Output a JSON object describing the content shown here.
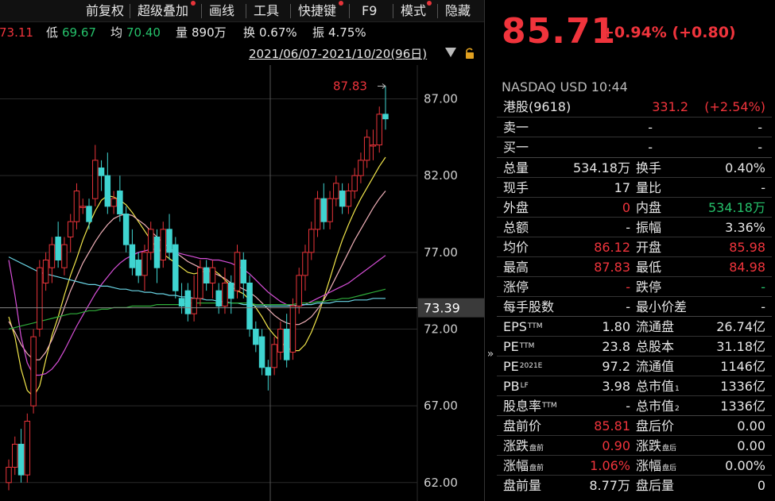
{
  "toolbar": {
    "items": [
      {
        "label": "前复权",
        "dot": false
      },
      {
        "label": "超级叠加",
        "dot": true
      },
      {
        "label": "画线",
        "dot": false
      },
      {
        "label": "工具",
        "dot": false
      },
      {
        "label": "快捷键",
        "dot": true
      },
      {
        "label": "F9",
        "dot": false
      },
      {
        "label": "模式",
        "dot": true
      },
      {
        "label": "隐藏",
        "dot": false
      }
    ]
  },
  "info": {
    "high_tail": "73.11",
    "low_label": "低",
    "low_value": "69.67",
    "avg_label": "均",
    "avg_value": "70.40",
    "vol_label": "量",
    "vol_value": "890万",
    "turn_label": "换",
    "turn_value": "0.67%",
    "amp_label": "振",
    "amp_value": "4.75%"
  },
  "date_range": "2021/06/07-2021/10/20(96日)",
  "chart_data": {
    "type": "candlestick",
    "y_ticks": [
      "87.00",
      "82.00",
      "77.00",
      "72.00",
      "67.00",
      "62.00"
    ],
    "ylim": [
      60.8,
      89.2
    ],
    "current_price_tag": "73.39",
    "current_price": 73.39,
    "max_label": "87.83",
    "max_value": 87.83,
    "up_color": "#e8343a",
    "down_color": "#3fd4d0",
    "candles": [
      [
        62.0,
        63.0,
        61.5,
        63.5
      ],
      [
        63.0,
        64.5,
        62.5,
        65.0
      ],
      [
        64.5,
        62.5,
        62.0,
        65.5
      ],
      [
        62.5,
        66.0,
        62.0,
        66.5
      ],
      [
        67.0,
        71.5,
        66.5,
        72.0
      ],
      [
        72.0,
        76.0,
        71.5,
        76.5
      ],
      [
        75.0,
        76.5,
        74.5,
        77.0
      ],
      [
        76.0,
        77.5,
        75.0,
        78.0
      ],
      [
        78.0,
        76.5,
        76.0,
        79.0
      ],
      [
        76.0,
        77.5,
        75.5,
        78.0
      ],
      [
        78.0,
        79.0,
        77.0,
        79.5
      ],
      [
        79.0,
        81.0,
        78.5,
        81.5
      ],
      [
        80.0,
        80.0,
        79.5,
        80.5
      ],
      [
        80.0,
        79.0,
        78.5,
        80.5
      ],
      [
        80.5,
        83.0,
        80.0,
        84.0
      ],
      [
        82.5,
        82.0,
        81.0,
        83.0
      ],
      [
        82.0,
        80.0,
        79.5,
        83.5
      ],
      [
        80.0,
        80.5,
        79.5,
        81.0
      ],
      [
        81.0,
        79.5,
        79.0,
        82.0
      ],
      [
        79.5,
        77.5,
        77.0,
        80.0
      ],
      [
        77.5,
        76.0,
        75.5,
        78.5
      ],
      [
        76.5,
        75.5,
        75.0,
        77.0
      ],
      [
        75.5,
        77.0,
        74.5,
        77.5
      ],
      [
        77.0,
        78.5,
        76.5,
        79.0
      ],
      [
        78.0,
        76.0,
        75.0,
        78.5
      ],
      [
        76.5,
        78.5,
        76.0,
        79.0
      ],
      [
        78.5,
        77.0,
        76.5,
        79.5
      ],
      [
        77.5,
        74.5,
        74.0,
        78.0
      ],
      [
        74.0,
        73.5,
        73.0,
        75.0
      ],
      [
        74.5,
        73.0,
        72.5,
        75.0
      ],
      [
        73.0,
        74.0,
        72.5,
        75.5
      ],
      [
        74.0,
        76.0,
        73.5,
        76.5
      ],
      [
        76.0,
        75.0,
        74.5,
        76.5
      ],
      [
        75.0,
        76.0,
        74.0,
        76.5
      ],
      [
        74.5,
        73.5,
        73.0,
        75.0
      ],
      [
        73.5,
        75.0,
        73.0,
        76.0
      ],
      [
        75.0,
        74.0,
        73.0,
        75.5
      ],
      [
        74.5,
        77.0,
        74.0,
        77.5
      ],
      [
        76.5,
        75.0,
        74.0,
        77.0
      ],
      [
        75.0,
        72.0,
        71.5,
        75.5
      ],
      [
        72.0,
        71.0,
        70.5,
        72.5
      ],
      [
        71.5,
        69.5,
        69.0,
        72.0
      ],
      [
        69.5,
        69.0,
        68.0,
        70.0
      ],
      [
        69.5,
        71.0,
        69.0,
        71.5
      ],
      [
        70.5,
        72.0,
        70.0,
        72.5
      ],
      [
        72.0,
        70.0,
        69.5,
        73.0
      ],
      [
        70.5,
        73.5,
        70.0,
        74.0
      ],
      [
        73.5,
        75.5,
        73.0,
        76.0
      ],
      [
        75.5,
        77.0,
        74.5,
        77.5
      ],
      [
        77.0,
        78.5,
        76.5,
        79.0
      ],
      [
        78.5,
        80.5,
        78.0,
        81.0
      ],
      [
        80.5,
        79.0,
        78.5,
        81.5
      ],
      [
        79.0,
        80.5,
        78.5,
        81.0
      ],
      [
        80.5,
        81.5,
        80.0,
        82.0
      ],
      [
        81.0,
        80.0,
        79.5,
        81.5
      ],
      [
        80.0,
        81.0,
        79.5,
        81.5
      ],
      [
        81.0,
        82.0,
        80.5,
        82.5
      ],
      [
        82.0,
        83.0,
        81.5,
        83.5
      ],
      [
        83.0,
        84.5,
        82.5,
        85.0
      ],
      [
        84.0,
        84.0,
        83.0,
        85.0
      ],
      [
        84.0,
        86.0,
        83.5,
        86.5
      ],
      [
        86.0,
        85.7,
        85.0,
        87.83
      ]
    ],
    "ma_lines": [
      {
        "color": "#f2e64b",
        "values": [
          72.8,
          71.5,
          69.4,
          68.0,
          67.6,
          68.3,
          70.0,
          71.6,
          72.8,
          74.2,
          75.5,
          76.6,
          77.8,
          78.8,
          79.7,
          80.4,
          80.7,
          80.6,
          80.4,
          80.1,
          79.6,
          79.0,
          78.4,
          77.8,
          77.3,
          76.9,
          76.6,
          76.3,
          76.0,
          75.7,
          75.6,
          75.7,
          75.8,
          75.9,
          75.6,
          75.2,
          74.8,
          74.5,
          74.3,
          73.9,
          73.4,
          72.8,
          72.1,
          71.6,
          71.2,
          70.8,
          70.6,
          70.6,
          71.0,
          71.8,
          72.8,
          74.0,
          75.3,
          76.6,
          77.8,
          78.8,
          79.7,
          80.5,
          81.2,
          81.9,
          82.6,
          83.2
        ]
      },
      {
        "color": "#f0b0b8",
        "values": [
          72.5,
          71.8,
          71.0,
          70.4,
          70.0,
          70.0,
          70.5,
          71.3,
          72.3,
          73.4,
          74.5,
          75.4,
          76.3,
          77.0,
          77.7,
          78.3,
          78.8,
          79.2,
          79.4,
          79.5,
          79.4,
          79.1,
          78.8,
          78.4,
          78.0,
          77.6,
          77.3,
          77.0,
          76.7,
          76.4,
          76.2,
          76.0,
          75.8,
          75.7,
          75.5,
          75.3,
          75.0,
          74.8,
          74.6,
          74.4,
          74.1,
          73.7,
          73.3,
          72.9,
          72.6,
          72.4,
          72.3,
          72.3,
          72.5,
          72.8,
          73.3,
          73.9,
          74.6,
          75.4,
          76.2,
          77.0,
          77.8,
          78.5,
          79.2,
          79.9,
          80.5,
          81.0
        ]
      },
      {
        "color": "#d74fd8",
        "values": [
          76.5,
          74.2,
          71.5,
          69.8,
          69.0,
          69.0,
          69.1,
          69.4,
          69.9,
          70.6,
          71.4,
          72.2,
          72.9,
          73.6,
          74.3,
          74.9,
          75.4,
          75.9,
          76.3,
          76.6,
          76.8,
          77.0,
          77.1,
          77.2,
          77.2,
          77.2,
          77.1,
          77.0,
          76.9,
          76.8,
          76.7,
          76.6,
          76.6,
          76.5,
          76.5,
          76.4,
          76.3,
          76.1,
          75.9,
          75.6,
          75.2,
          74.8,
          74.4,
          74.1,
          73.8,
          73.6,
          73.5,
          73.5,
          73.6,
          73.8,
          74.0,
          74.2,
          74.4,
          74.6,
          74.8,
          75.0,
          75.3,
          75.6,
          75.9,
          76.2,
          76.5,
          76.8
        ]
      },
      {
        "color": "#6ad6e6",
        "values": [
          76.7,
          76.5,
          76.3,
          76.1,
          75.9,
          75.7,
          75.6,
          75.5,
          75.4,
          75.3,
          75.2,
          75.1,
          75.0,
          74.9,
          74.9,
          74.8,
          74.8,
          74.7,
          74.6,
          74.6,
          74.5,
          74.5,
          74.4,
          74.4,
          74.3,
          74.3,
          74.2,
          74.2,
          74.1,
          74.1,
          74.0,
          74.0,
          73.9,
          73.9,
          73.8,
          73.8,
          73.7,
          73.7,
          73.6,
          73.6,
          73.5,
          73.5,
          73.5,
          73.5,
          73.5,
          73.5,
          73.5,
          73.6,
          73.6,
          73.6,
          73.7,
          73.7,
          73.7,
          73.8,
          73.8,
          73.8,
          73.9,
          73.9,
          73.9,
          74.0,
          74.0,
          74.0
        ]
      },
      {
        "color": "#2fae3a",
        "values": [
          72.0,
          72.1,
          72.2,
          72.3,
          72.4,
          72.5,
          72.6,
          72.7,
          72.8,
          72.9,
          73.0,
          73.0,
          73.1,
          73.2,
          73.2,
          73.3,
          73.3,
          73.4,
          73.4,
          73.4,
          73.5,
          73.5,
          73.5,
          73.5,
          73.6,
          73.6,
          73.6,
          73.6,
          73.6,
          73.7,
          73.7,
          73.7,
          73.7,
          73.7,
          73.7,
          73.7,
          73.7,
          73.7,
          73.7,
          73.7,
          73.6,
          73.6,
          73.6,
          73.6,
          73.6,
          73.6,
          73.6,
          73.7,
          73.7,
          73.7,
          73.8,
          73.8,
          73.9,
          73.9,
          74.0,
          74.0,
          74.1,
          74.2,
          74.3,
          74.4,
          74.5,
          74.6
        ]
      }
    ]
  },
  "quote": {
    "price": "85.71",
    "change": "+0.94% (+0.80)",
    "exchange": "NASDAQ  USD  10:44",
    "hk_label": "港股(9618)",
    "hk_price": "331.2",
    "hk_change": "(+2.54%)",
    "sell1_label": "卖一",
    "sell1_a": "-",
    "sell1_b": "-",
    "buy1_label": "买一",
    "buy1_a": "-",
    "buy1_b": "-",
    "stats": [
      {
        "l1": "总量",
        "v1": "534.18万",
        "c1": "wht",
        "l2": "换手",
        "v2": "0.40%",
        "c2": "wht"
      },
      {
        "l1": "现手",
        "v1": "17",
        "c1": "wht",
        "l2": "量比",
        "v2": "-",
        "c2": "wht"
      },
      {
        "l1": "外盘",
        "v1": "0",
        "c1": "red",
        "l2": "内盘",
        "v2": "534.18万",
        "c2": "green"
      },
      {
        "l1": "总额",
        "v1": "-",
        "c1": "wht",
        "l2": "振幅",
        "v2": "3.36%",
        "c2": "wht"
      },
      {
        "l1": "均价",
        "v1": "86.12",
        "c1": "red",
        "l2": "开盘",
        "v2": "85.98",
        "c2": "red"
      },
      {
        "l1": "最高",
        "v1": "87.83",
        "c1": "red",
        "l2": "最低",
        "v2": "84.98",
        "c2": "red"
      },
      {
        "l1": "涨停",
        "v1": "-",
        "c1": "red",
        "l2": "跌停",
        "v2": "-",
        "c2": "green"
      },
      {
        "l1": "每手股数",
        "v1": "-",
        "c1": "wht",
        "l2": "最小价差",
        "v2": "-",
        "c2": "wht"
      }
    ],
    "fundamentals": [
      {
        "l1": "EPS",
        "s1": "TTM",
        "v1": "1.80",
        "l2": "流通盘",
        "s2": "",
        "v2": "26.74亿"
      },
      {
        "l1": "PE",
        "s1": "TTM",
        "v1": "23.8",
        "l2": "总股本",
        "s2": "",
        "v2": "31.18亿"
      },
      {
        "l1": "PE",
        "s1": "2021E",
        "v1": "97.2",
        "l2": "流通值",
        "s2": "",
        "v2": "1146亿"
      },
      {
        "l1": "PB",
        "s1": "LF",
        "v1": "3.98",
        "l2": "总市值",
        "s2": "1",
        "v2": "1336亿"
      },
      {
        "l1": "股息率",
        "s1": "TTM",
        "v1": "-",
        "l2": "总市值",
        "s2": "2",
        "v2": "1336亿"
      }
    ],
    "premarket": [
      {
        "l1": "盘前价",
        "s1": "",
        "v1": "85.81",
        "c1": "red",
        "l2": "盘后价",
        "s2": "",
        "v2": "0.00",
        "c2": "wht"
      },
      {
        "l1": "涨跌",
        "s1": "盘前",
        "v1": "0.90",
        "c1": "red",
        "l2": "涨跌",
        "s2": "盘后",
        "v2": "0.00",
        "c2": "wht"
      },
      {
        "l1": "涨幅",
        "s1": "盘前",
        "v1": "1.06%",
        "c1": "red",
        "l2": "涨幅",
        "s2": "盘后",
        "v2": "0.00%",
        "c2": "wht"
      },
      {
        "l1": "盘前量",
        "s1": "",
        "v1": "8.77万",
        "c1": "wht",
        "l2": "盘后量",
        "s2": "",
        "v2": "0",
        "c2": "wht"
      }
    ]
  }
}
